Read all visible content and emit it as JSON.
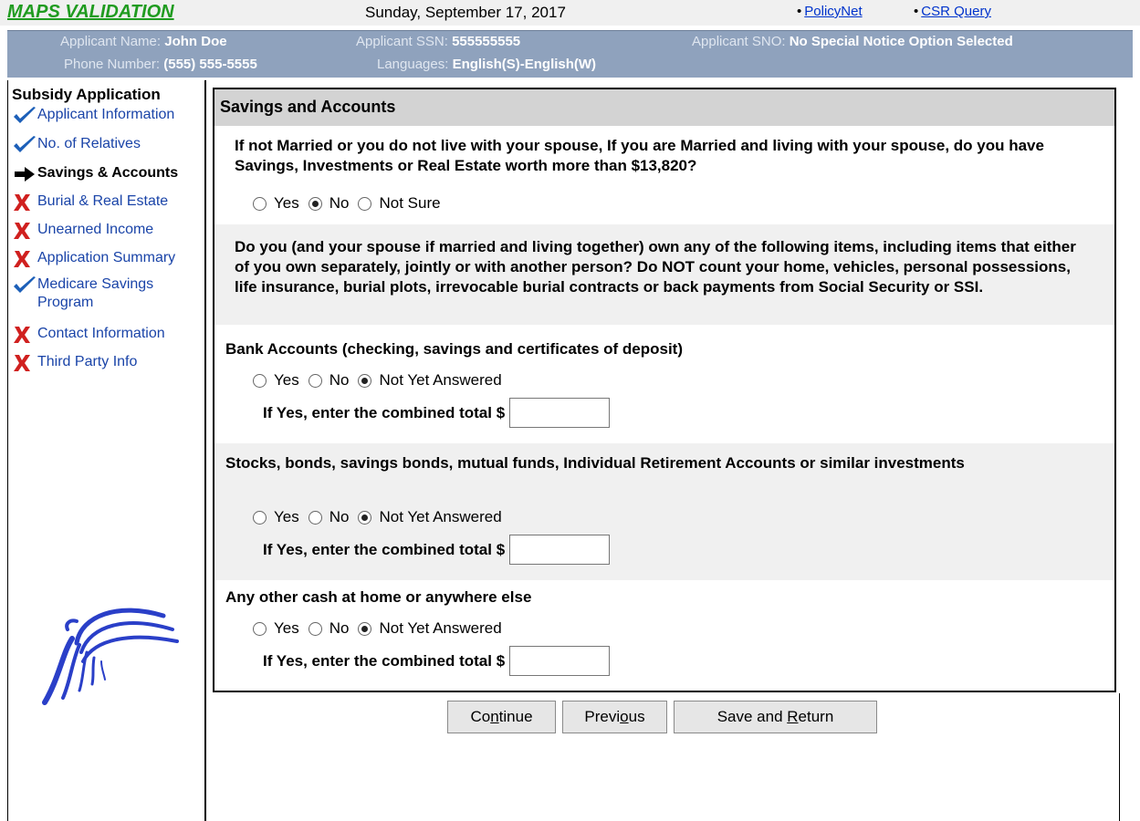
{
  "topbar": {
    "app_title": "MAPS VALIDATION",
    "date": "Sunday, September 17, 2017",
    "links": [
      {
        "label": "PolicyNet"
      },
      {
        "label": "CSR Query"
      }
    ]
  },
  "applicant": {
    "name_label": "Applicant Name:",
    "name_value": "John Doe",
    "ssn_label": "Applicant SSN:",
    "ssn_value": "555555555",
    "sno_label": "Applicant SNO:",
    "sno_value": "No Special Notice Option Selected",
    "phone_label": "Phone Number:",
    "phone_value": "(555) 555-5555",
    "languages_label": "Languages:",
    "languages_value": "English(S)-English(W)"
  },
  "sidebar": {
    "title": "Subsidy Application",
    "items": [
      {
        "label": "Applicant Information",
        "status": "complete"
      },
      {
        "label": "No. of Relatives",
        "status": "complete"
      },
      {
        "label": "Savings & Accounts",
        "status": "current"
      },
      {
        "label": "Burial & Real Estate",
        "status": "incomplete"
      },
      {
        "label": "Unearned Income",
        "status": "incomplete"
      },
      {
        "label": "Application Summary",
        "status": "incomplete"
      },
      {
        "label": "Medicare Savings Program",
        "status": "complete"
      },
      {
        "label": "Contact Information",
        "status": "incomplete"
      },
      {
        "label": "Third Party Info",
        "status": "incomplete"
      }
    ]
  },
  "form": {
    "title": "Savings and Accounts",
    "q1": {
      "text": "If not Married or you do not live with your spouse, If you are Married and living with your spouse, do you have Savings, Investments or Real Estate worth more than $13,820?",
      "options": [
        "Yes",
        "No",
        "Not Sure"
      ],
      "selected": "No"
    },
    "intro": "Do you (and your spouse if married and living together) own any of the following items, including items that either of you own separately, jointly or with another person? Do NOT count your home, vehicles, personal possessions, life insurance, burial plots, irrevocable burial contracts or back payments from Social Security or SSI.",
    "items": [
      {
        "question": "Bank Accounts (checking, savings and certificates of deposit)",
        "options": [
          "Yes",
          "No",
          "Not Yet Answered"
        ],
        "selected": "Not Yet Answered",
        "total_label": "If Yes, enter the combined total $",
        "total_value": ""
      },
      {
        "question": "Stocks, bonds, savings bonds, mutual funds, Individual Retirement Accounts or similar investments",
        "options": [
          "Yes",
          "No",
          "Not Yet Answered"
        ],
        "selected": "Not Yet Answered",
        "total_label": "If Yes, enter the combined total $",
        "total_value": ""
      },
      {
        "question": "Any other cash at home or anywhere else",
        "options": [
          "Yes",
          "No",
          "Not Yet Answered"
        ],
        "selected": "Not Yet Answered",
        "total_label": "If Yes, enter the combined total $",
        "total_value": ""
      }
    ]
  },
  "buttons": {
    "continue": {
      "pre": "Co",
      "u": "n",
      "post": "tinue"
    },
    "previous": {
      "pre": "Previ",
      "u": "o",
      "post": "us"
    },
    "save": {
      "pre": "Save and ",
      "u": "R",
      "post": "eturn"
    }
  },
  "colors": {
    "title_green": "#1f9b1f",
    "header_blue": "#8fa2bd",
    "link_blue": "#1a44a8",
    "check_blue": "#1c5fb8",
    "x_red": "#d0201f"
  }
}
